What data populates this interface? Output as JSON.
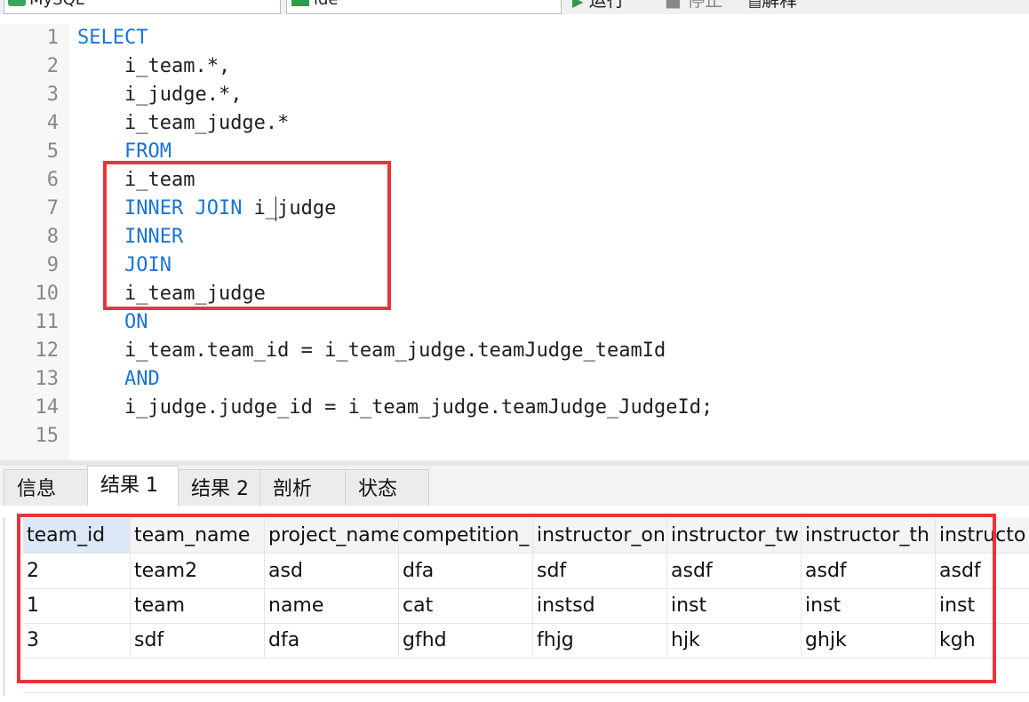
{
  "toolbar": {
    "connection": "MySQL",
    "database": "ide",
    "run_label": "运行",
    "stop_label": "停止",
    "explain_label": "解释"
  },
  "editor": {
    "lines": [
      {
        "n": "1",
        "indent": "",
        "parts": [
          {
            "t": "SELECT",
            "kw": true
          }
        ]
      },
      {
        "n": "2",
        "indent": "    ",
        "parts": [
          {
            "t": "i_team.*,",
            "kw": false
          }
        ]
      },
      {
        "n": "3",
        "indent": "    ",
        "parts": [
          {
            "t": "i_judge.*,",
            "kw": false
          }
        ]
      },
      {
        "n": "4",
        "indent": "    ",
        "parts": [
          {
            "t": "i_team_judge.*",
            "kw": false
          }
        ]
      },
      {
        "n": "5",
        "indent": "    ",
        "parts": [
          {
            "t": "FROM",
            "kw": true
          }
        ]
      },
      {
        "n": "6",
        "indent": "    ",
        "parts": [
          {
            "t": "i_team",
            "kw": false
          }
        ]
      },
      {
        "n": "7",
        "indent": "    ",
        "parts": [
          {
            "t": "INNER JOIN",
            "kw": true
          },
          {
            "t": " i_judge",
            "kw": false
          }
        ]
      },
      {
        "n": "8",
        "indent": "    ",
        "parts": [
          {
            "t": "INNER",
            "kw": true
          }
        ]
      },
      {
        "n": "9",
        "indent": "    ",
        "parts": [
          {
            "t": "JOIN",
            "kw": true
          }
        ]
      },
      {
        "n": "10",
        "indent": "    ",
        "parts": [
          {
            "t": "i_team_judge",
            "kw": false
          }
        ]
      },
      {
        "n": "11",
        "indent": "    ",
        "parts": [
          {
            "t": "ON",
            "kw": true
          }
        ]
      },
      {
        "n": "12",
        "indent": "    ",
        "parts": [
          {
            "t": "i_team.team_id = i_team_judge.teamJudge_teamId",
            "kw": false
          }
        ]
      },
      {
        "n": "13",
        "indent": "    ",
        "parts": [
          {
            "t": "AND",
            "kw": true
          }
        ]
      },
      {
        "n": "14",
        "indent": "    ",
        "parts": [
          {
            "t": "i_judge.judge_id = i_team_judge.teamJudge_JudgeId;",
            "kw": false
          }
        ]
      },
      {
        "n": "15",
        "indent": "",
        "parts": []
      }
    ]
  },
  "tabs": [
    {
      "label": "信息",
      "active": false
    },
    {
      "label": "结果 1",
      "active": true
    },
    {
      "label": "结果 2",
      "active": false
    },
    {
      "label": "剖析",
      "active": false
    },
    {
      "label": "状态",
      "active": false
    }
  ],
  "grid": {
    "columns": [
      "team_id",
      "team_name",
      "project_name",
      "competition_",
      "instructor_on",
      "instructor_tw",
      "instructor_th",
      "instructo"
    ],
    "rows": [
      [
        "2",
        "team2",
        "asd",
        "dfa",
        "sdf",
        "asdf",
        "asdf",
        "asdf"
      ],
      [
        "1",
        "team",
        "name",
        "cat",
        "instsd",
        "inst",
        "inst",
        "inst"
      ],
      [
        "3",
        "sdf",
        "dfa",
        "gfhd",
        "fhjg",
        "hjk",
        "ghjk",
        "kgh"
      ]
    ]
  },
  "colors": {
    "keyword": "#1a74d6",
    "annotation_box": "#e8353b",
    "selected_header": "#dce8f6"
  }
}
